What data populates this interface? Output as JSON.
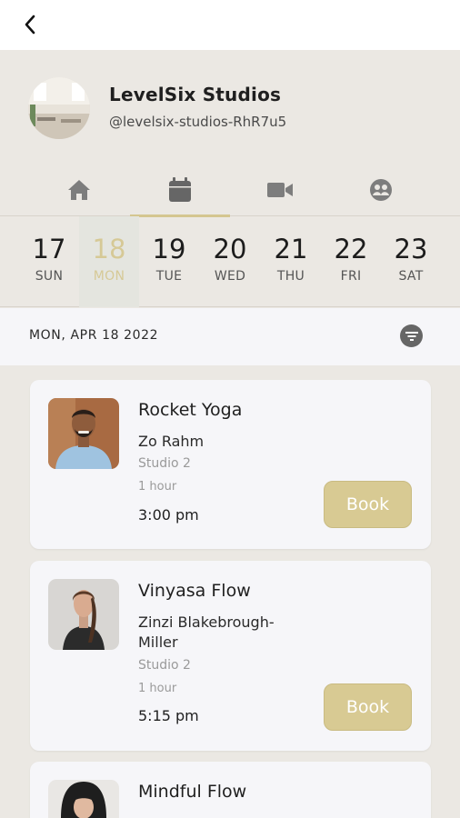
{
  "header": {
    "back_icon": "chevron-left-icon"
  },
  "studio": {
    "name": "LevelSix Studios",
    "handle": "@levelsix-studios-RhR7u5"
  },
  "tabs": [
    {
      "icon": "home-icon",
      "active": false
    },
    {
      "icon": "calendar-icon",
      "active": true
    },
    {
      "icon": "video-camera-icon",
      "active": false
    },
    {
      "icon": "community-icon",
      "active": false
    }
  ],
  "days": [
    {
      "num": "17",
      "name": "SUN"
    },
    {
      "num": "18",
      "name": "MON",
      "selected": true
    },
    {
      "num": "19",
      "name": "TUE"
    },
    {
      "num": "20",
      "name": "WED"
    },
    {
      "num": "21",
      "name": "THU"
    },
    {
      "num": "22",
      "name": "FRI"
    },
    {
      "num": "23",
      "name": "SAT"
    }
  ],
  "schedule": {
    "date_label": "MON, APR 18 2022",
    "filter_icon": "filter-icon"
  },
  "classes": [
    {
      "title": "Rocket Yoga",
      "instructor": "Zo Rahm",
      "room": "Studio 2",
      "duration": "1 hour",
      "time": "3:00 pm",
      "button": "Book"
    },
    {
      "title": "Vinyasa Flow",
      "instructor": "Zinzi  Blakebrough-Miller",
      "room": "Studio 2",
      "duration": "1 hour",
      "time": "5:15 pm",
      "button": "Book"
    },
    {
      "title": "Mindful Flow"
    }
  ],
  "colors": {
    "accent": "#d8ca93",
    "background": "#ebe8e3",
    "card": "#f6f6f9"
  }
}
